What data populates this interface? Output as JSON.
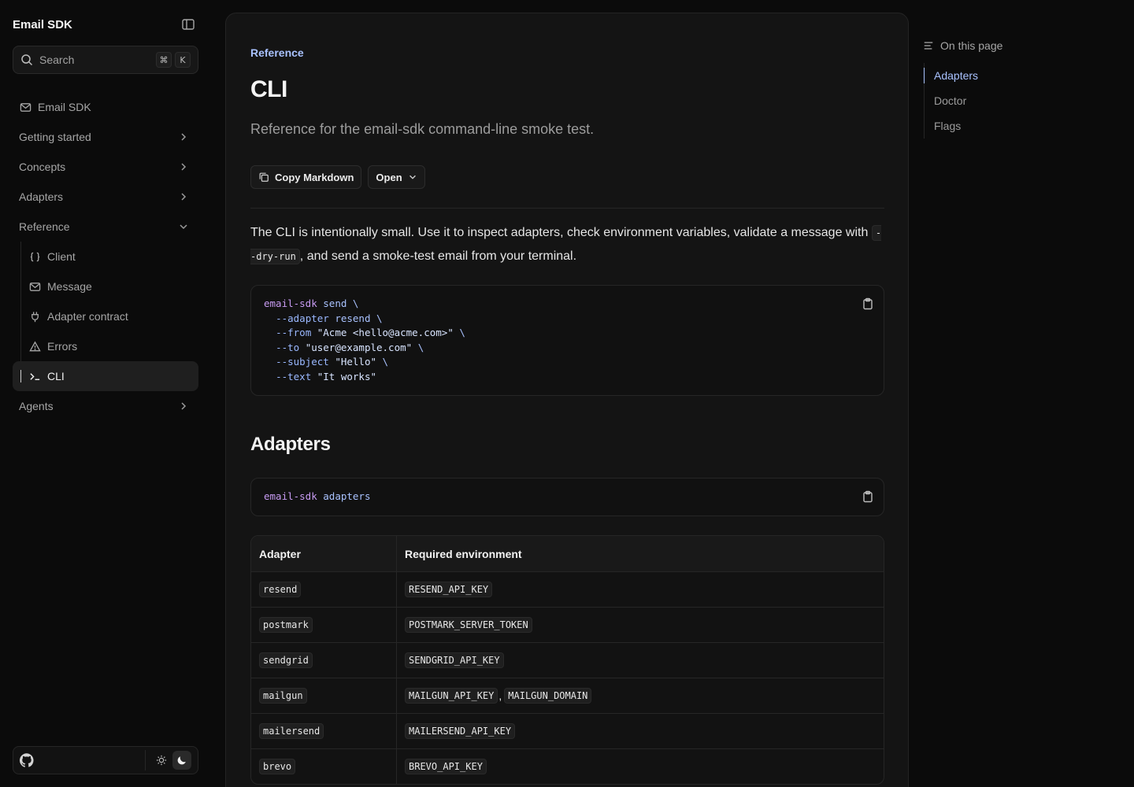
{
  "app": {
    "title": "Email SDK"
  },
  "search": {
    "placeholder": "Search",
    "shortcut_mod": "⌘",
    "shortcut_key": "K"
  },
  "sidebar": {
    "items": [
      {
        "label": "Email SDK"
      },
      {
        "label": "Getting started"
      },
      {
        "label": "Concepts"
      },
      {
        "label": "Adapters"
      },
      {
        "label": "Reference"
      },
      {
        "label": "Client"
      },
      {
        "label": "Message"
      },
      {
        "label": "Adapter contract"
      },
      {
        "label": "Errors"
      },
      {
        "label": "CLI"
      },
      {
        "label": "Agents"
      }
    ]
  },
  "page": {
    "breadcrumb": "Reference",
    "title": "CLI",
    "subtitle": "Reference for the email-sdk command-line smoke test.",
    "copy_markdown": "Copy Markdown",
    "open": "Open",
    "intro_before": "The CLI is intentionally small. Use it to inspect adapters, check environment variables, validate a message with ",
    "intro_code": "--dry-run",
    "intro_after": ", and send a smoke-test email from your terminal.",
    "code1": {
      "l1_cmd": "email-sdk",
      "l1_arg": "send",
      "l1_end": "\\",
      "l2_flag": "--adapter",
      "l2_val": "resend",
      "l2_end": "\\",
      "l3_flag": "--from",
      "l3_str": "\"Acme <hello@acme.com>\"",
      "l3_end": "\\",
      "l4_flag": "--to",
      "l4_str": "\"user@example.com\"",
      "l4_end": "\\",
      "l5_flag": "--subject",
      "l5_str": "\"Hello\"",
      "l5_end": "\\",
      "l6_flag": "--text",
      "l6_str": "\"It works\""
    },
    "adapters_heading": "Adapters",
    "code2": {
      "cmd": "email-sdk",
      "arg": "adapters"
    },
    "table": {
      "headers": [
        "Adapter",
        "Required environment"
      ],
      "rows": [
        {
          "adapter": "resend",
          "env1": "RESEND_API_KEY"
        },
        {
          "adapter": "postmark",
          "env1": "POSTMARK_SERVER_TOKEN"
        },
        {
          "adapter": "sendgrid",
          "env1": "SENDGRID_API_KEY"
        },
        {
          "adapter": "mailgun",
          "env1": "MAILGUN_API_KEY",
          "sep": ",",
          "env2": "MAILGUN_DOMAIN"
        },
        {
          "adapter": "mailersend",
          "env1": "MAILERSEND_API_KEY"
        },
        {
          "adapter": "brevo",
          "env1": "BREVO_API_KEY"
        }
      ]
    }
  },
  "toc": {
    "title": "On this page",
    "items": [
      {
        "label": "Adapters"
      },
      {
        "label": "Doctor"
      },
      {
        "label": "Flags"
      }
    ]
  },
  "colors": {
    "accent": "#a9c2ff",
    "background": "#0b0b0b",
    "panel": "#141414",
    "token_command": "#c79bf2"
  }
}
